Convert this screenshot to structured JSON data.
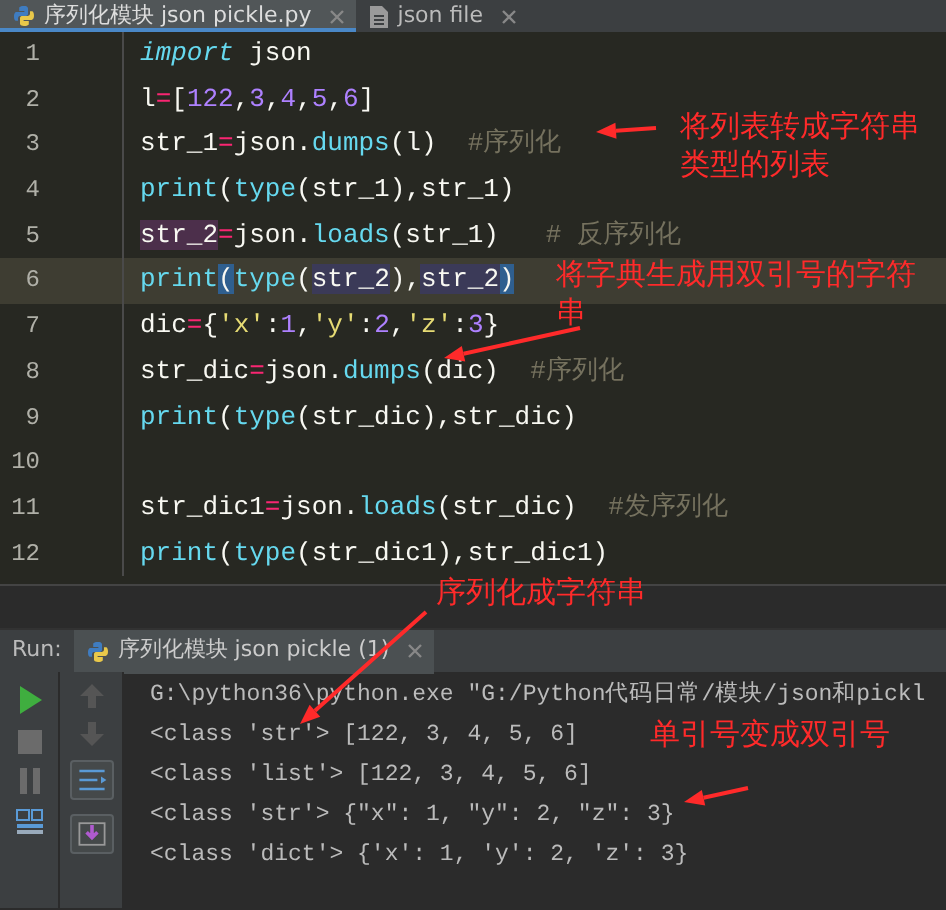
{
  "tabs": [
    {
      "label": "序列化模块 json pickle.py",
      "selected": true
    },
    {
      "label": "json file",
      "selected": false
    }
  ],
  "editor": {
    "lines": [
      {
        "number": "1",
        "current": false,
        "tokens": [
          {
            "t": "import",
            "kind": "keyword"
          },
          {
            "t": " json",
            "kind": "plain"
          }
        ]
      },
      {
        "number": "2",
        "current": false,
        "tokens": [
          {
            "t": "l",
            "kind": "plain"
          },
          {
            "t": "=",
            "kind": "op"
          },
          {
            "t": "[",
            "kind": "plain"
          },
          {
            "t": "122",
            "kind": "num"
          },
          {
            "t": ",",
            "kind": "plain"
          },
          {
            "t": "3",
            "kind": "num"
          },
          {
            "t": ",",
            "kind": "plain"
          },
          {
            "t": "4",
            "kind": "num"
          },
          {
            "t": ",",
            "kind": "plain"
          },
          {
            "t": "5",
            "kind": "num"
          },
          {
            "t": ",",
            "kind": "plain"
          },
          {
            "t": "6",
            "kind": "num"
          },
          {
            "t": "]",
            "kind": "plain"
          }
        ]
      },
      {
        "number": "3",
        "current": false,
        "tokens": [
          {
            "t": "str_1",
            "kind": "plain"
          },
          {
            "t": "=",
            "kind": "op"
          },
          {
            "t": "json.",
            "kind": "plain"
          },
          {
            "t": "dumps",
            "kind": "func"
          },
          {
            "t": "(l)",
            "kind": "plain"
          },
          {
            "t": "  #序列化",
            "kind": "comment"
          }
        ]
      },
      {
        "number": "4",
        "current": false,
        "tokens": [
          {
            "t": "print",
            "kind": "func"
          },
          {
            "t": "(",
            "kind": "plain"
          },
          {
            "t": "type",
            "kind": "func"
          },
          {
            "t": "(str_1),str_1)",
            "kind": "plain"
          }
        ]
      },
      {
        "number": "5",
        "current": false,
        "tokens": [
          {
            "t": "str_2",
            "kind": "write"
          },
          {
            "t": "=",
            "kind": "op"
          },
          {
            "t": "json.",
            "kind": "plain"
          },
          {
            "t": "loads",
            "kind": "func"
          },
          {
            "t": "(str_1)",
            "kind": "plain"
          },
          {
            "t": "   # 反序列化",
            "kind": "comment"
          }
        ]
      },
      {
        "number": "6",
        "current": true,
        "tokens": [
          {
            "t": "print",
            "kind": "func"
          },
          {
            "t": "(",
            "kind": "bracket"
          },
          {
            "t": "type",
            "kind": "func"
          },
          {
            "t": "(",
            "kind": "plain"
          },
          {
            "t": "str_2",
            "kind": "read"
          },
          {
            "t": "),",
            "kind": "plain"
          },
          {
            "t": "str_2",
            "kind": "read"
          },
          {
            "t": ")",
            "kind": "bracket"
          }
        ]
      },
      {
        "number": "7",
        "current": false,
        "tokens": [
          {
            "t": "dic",
            "kind": "plain"
          },
          {
            "t": "=",
            "kind": "op"
          },
          {
            "t": "{",
            "kind": "plain"
          },
          {
            "t": "'x'",
            "kind": "str"
          },
          {
            "t": ":",
            "kind": "plain"
          },
          {
            "t": "1",
            "kind": "num"
          },
          {
            "t": ",",
            "kind": "plain"
          },
          {
            "t": "'y'",
            "kind": "str"
          },
          {
            "t": ":",
            "kind": "plain"
          },
          {
            "t": "2",
            "kind": "num"
          },
          {
            "t": ",",
            "kind": "plain"
          },
          {
            "t": "'z'",
            "kind": "str"
          },
          {
            "t": ":",
            "kind": "plain"
          },
          {
            "t": "3",
            "kind": "num"
          },
          {
            "t": "}",
            "kind": "plain"
          }
        ]
      },
      {
        "number": "8",
        "current": false,
        "tokens": [
          {
            "t": "str_dic",
            "kind": "plain"
          },
          {
            "t": "=",
            "kind": "op"
          },
          {
            "t": "json.",
            "kind": "plain"
          },
          {
            "t": "dumps",
            "kind": "func"
          },
          {
            "t": "(dic)",
            "kind": "plain"
          },
          {
            "t": "  #序列化",
            "kind": "comment"
          }
        ]
      },
      {
        "number": "9",
        "current": false,
        "tokens": [
          {
            "t": "print",
            "kind": "func"
          },
          {
            "t": "(",
            "kind": "plain"
          },
          {
            "t": "type",
            "kind": "func"
          },
          {
            "t": "(str_dic),str_dic)",
            "kind": "plain"
          }
        ]
      },
      {
        "number": "10",
        "current": false
      },
      {
        "number": "11",
        "current": false,
        "tokens": [
          {
            "t": "str_dic1",
            "kind": "plain"
          },
          {
            "t": "=",
            "kind": "op"
          },
          {
            "t": "json.",
            "kind": "plain"
          },
          {
            "t": "loads",
            "kind": "func"
          },
          {
            "t": "(str_dic)",
            "kind": "plain"
          },
          {
            "t": "  #发序列化",
            "kind": "comment"
          }
        ]
      },
      {
        "number": "12",
        "current": false,
        "tokens": [
          {
            "t": "print",
            "kind": "func"
          },
          {
            "t": "(",
            "kind": "plain"
          },
          {
            "t": "type",
            "kind": "func"
          },
          {
            "t": "(str_dic1),str_dic1)",
            "kind": "plain"
          }
        ]
      }
    ]
  },
  "run_panel": {
    "label": "Run:",
    "tab": "序列化模块 json pickle (1)",
    "output": [
      "G:\\python36\\python.exe \"G:/Python代码日常/模块/json和pickl",
      "<class 'str'> [122, 3, 4, 5, 6]",
      "<class 'list'> [122, 3, 4, 5, 6]",
      "<class 'str'> {\"x\": 1, \"y\": 2, \"z\": 3}",
      "<class 'dict'> {'x': 1, 'y': 2, 'z': 3}"
    ]
  },
  "annotations": [
    {
      "text": "将列表转成字符串类型的列表"
    },
    {
      "text": "将字典生成用双引号的字符串"
    },
    {
      "text": "序列化成字符串"
    },
    {
      "text": "单引号变成双引号"
    }
  ]
}
